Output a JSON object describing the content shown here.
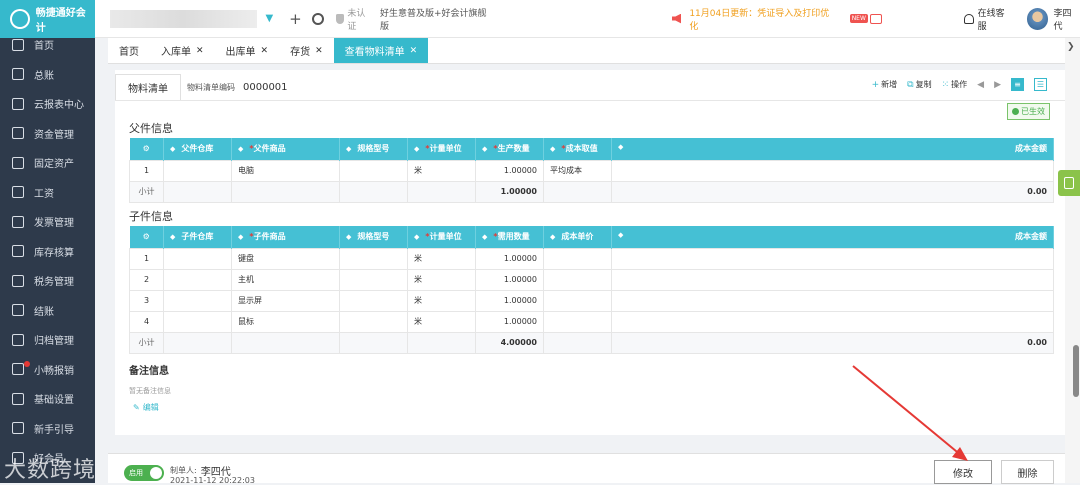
{
  "app": {
    "name": "畅捷通好会计",
    "product": "好生意普及版+好会计旗舰版",
    "certification": "未认证"
  },
  "header": {
    "notice": "11月04日更新：凭证导入及打印优化",
    "service": "在线客服",
    "user": "李四代"
  },
  "sidebar": {
    "items": [
      {
        "label": "首页"
      },
      {
        "label": "总账"
      },
      {
        "label": "云报表中心"
      },
      {
        "label": "资金管理"
      },
      {
        "label": "固定资产"
      },
      {
        "label": "工资"
      },
      {
        "label": "发票管理"
      },
      {
        "label": "库存核算"
      },
      {
        "label": "税务管理"
      },
      {
        "label": "结账"
      },
      {
        "label": "归档管理"
      },
      {
        "label": "小畅报销"
      },
      {
        "label": "基础设置"
      },
      {
        "label": "新手引导"
      },
      {
        "label": "好会员"
      }
    ]
  },
  "tabs": [
    {
      "label": "首页",
      "closable": false
    },
    {
      "label": "入库单",
      "closable": true
    },
    {
      "label": "出库单",
      "closable": true
    },
    {
      "label": "存货",
      "closable": true
    },
    {
      "label": "查看物料清单",
      "closable": true,
      "active": true
    }
  ],
  "form": {
    "subtab": "物料清单",
    "code_label": "物料清单编码",
    "code_value": "0000001",
    "status": "已生效",
    "actions": [
      "新增",
      "复制",
      "操作"
    ]
  },
  "parent": {
    "title": "父件信息",
    "columns": [
      "父件仓库",
      "父件商品",
      "规格型号",
      "计量单位",
      "生产数量",
      "成本取值",
      "成本金额"
    ],
    "rows": [
      {
        "no": "1",
        "warehouse": "",
        "goods": "电脑",
        "spec": "",
        "unit": "米",
        "qty": "1.00000",
        "cost_source": "平均成本",
        "amount": ""
      }
    ],
    "subtotal_label": "小计",
    "subtotal_qty": "1.00000",
    "subtotal_amount": "0.00"
  },
  "child": {
    "title": "子件信息",
    "columns": [
      "子件仓库",
      "子件商品",
      "规格型号",
      "计量单位",
      "需用数量",
      "成本单价",
      "成本金额"
    ],
    "rows": [
      {
        "no": "1",
        "goods": "键盘",
        "unit": "米",
        "qty": "1.00000"
      },
      {
        "no": "2",
        "goods": "主机",
        "unit": "米",
        "qty": "1.00000"
      },
      {
        "no": "3",
        "goods": "显示屏",
        "unit": "米",
        "qty": "1.00000"
      },
      {
        "no": "4",
        "goods": "鼠标",
        "unit": "米",
        "qty": "1.00000"
      }
    ],
    "subtotal_label": "小计",
    "subtotal_qty": "4.00000",
    "subtotal_amount": "0.00"
  },
  "remark": {
    "title": "备注信息",
    "empty": "暂无备注信息",
    "edit": "编辑"
  },
  "footer": {
    "toggle": "启用",
    "maker_label": "制单人:",
    "maker": "李四代",
    "time": "2021-11-12 20:22:03",
    "edit_button": "修改",
    "delete_button": "删除"
  },
  "watermark": "大数跨境"
}
